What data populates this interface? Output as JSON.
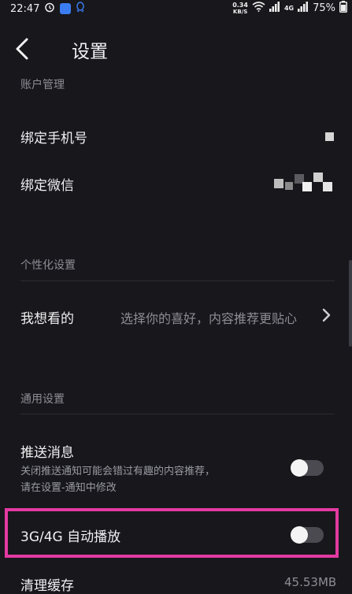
{
  "status_bar": {
    "time": "22:47",
    "net_speed_value": "0.34",
    "net_speed_unit": "KB/S",
    "network_type": "4G",
    "battery": "75%"
  },
  "header": {
    "title": "设置"
  },
  "sections": {
    "account": {
      "label": "账户管理",
      "phone_label": "绑定手机号",
      "wechat_label": "绑定微信"
    },
    "personalization": {
      "label": "个性化设置",
      "preference_label": "我想看的",
      "preference_value": "选择你的喜好，内容推荐更贴心"
    },
    "general": {
      "label": "通用设置",
      "push_label": "推送消息",
      "push_desc_1": "关闭推送通知可能会错过有趣的内容推荐，",
      "push_desc_2": "请在设置-通知中修改",
      "push_enabled": false,
      "autoplay_label": "3G/4G 自动播放",
      "autoplay_enabled": false,
      "cache_label": "清理缓存",
      "cache_value": "45.53MB"
    }
  },
  "colors": {
    "background": "#17171c",
    "highlight": "#e33aa1"
  }
}
